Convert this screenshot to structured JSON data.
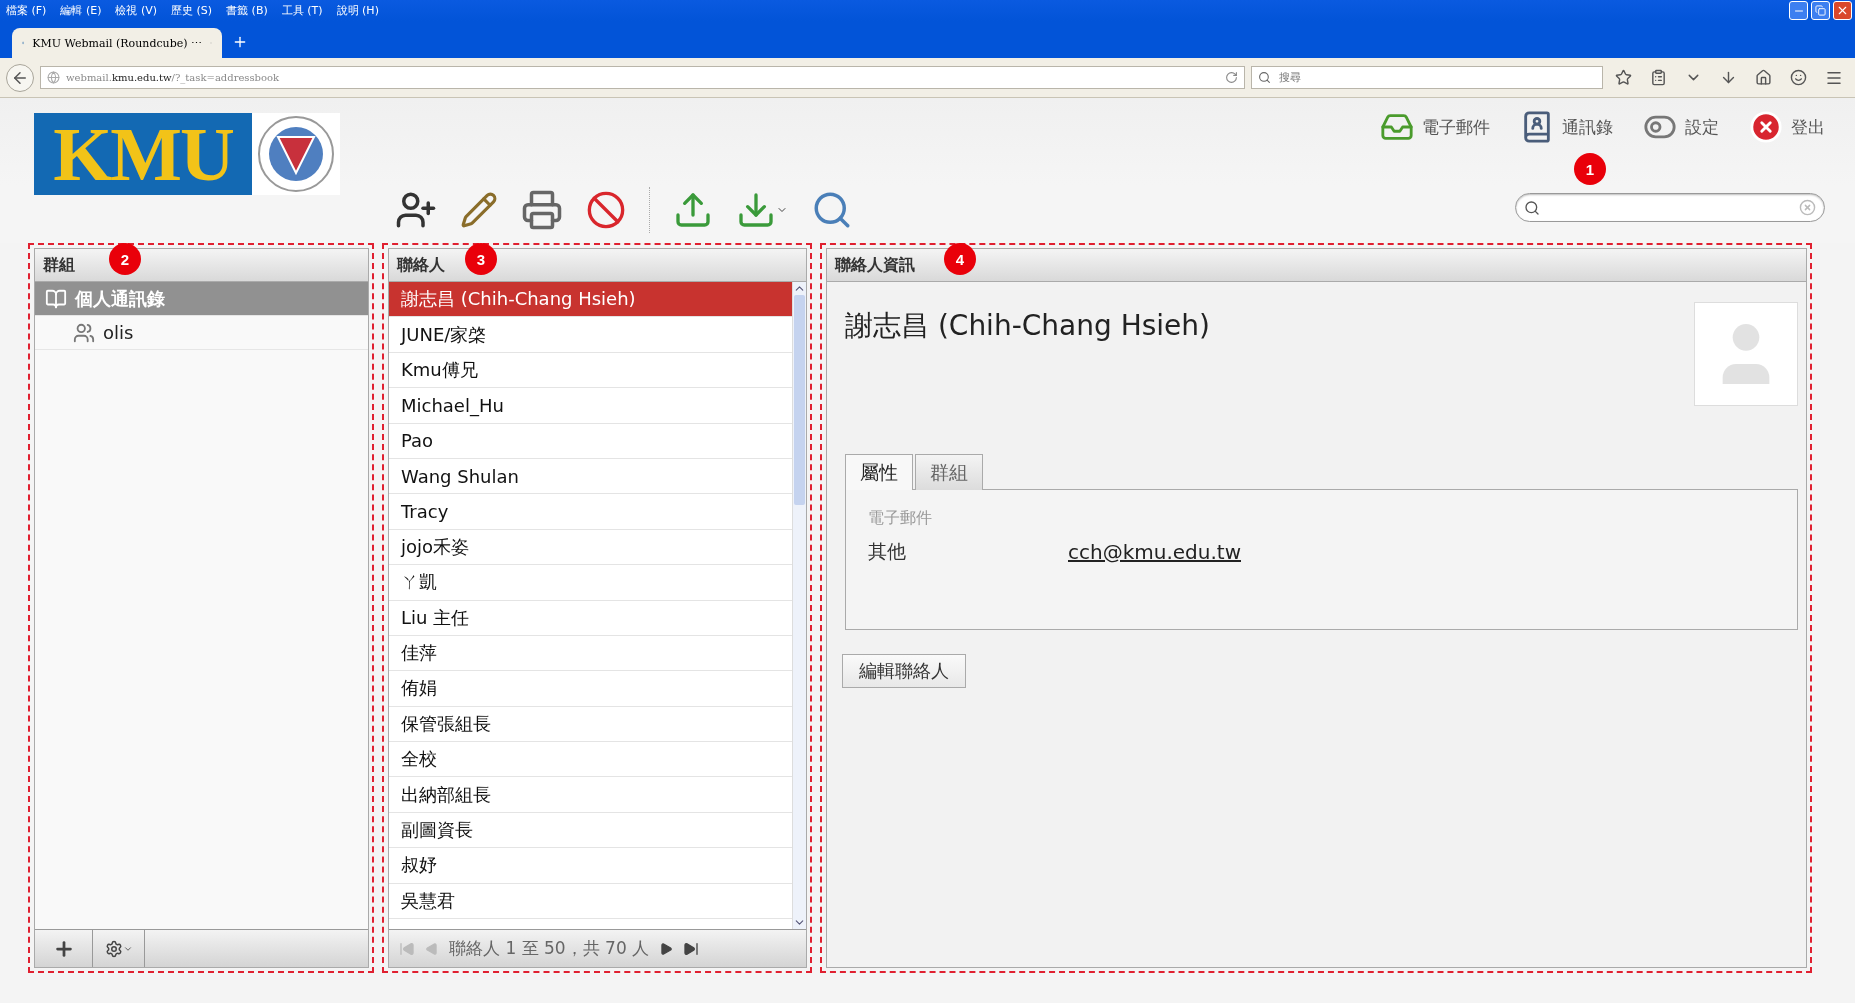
{
  "browser": {
    "menu": [
      "檔案 (F)",
      "編輯 (E)",
      "檢視 (V)",
      "歷史 (S)",
      "書籤 (B)",
      "工具 (T)",
      "說明 (H)"
    ],
    "tab": {
      "title": "KMU Webmail (Roundcube) ⋯"
    },
    "url": {
      "host": "webmail.",
      "domain": "kmu.edu.tw",
      "path": "/?_task=addressbook"
    },
    "search": {
      "placeholder": "搜尋"
    }
  },
  "app": {
    "logo_text": "KMU",
    "nav": [
      {
        "kind": "mail",
        "label": "電子郵件"
      },
      {
        "kind": "addressbook",
        "label": "通訊錄"
      },
      {
        "kind": "settings",
        "label": "設定"
      },
      {
        "kind": "logout",
        "label": "登出"
      }
    ],
    "nav_callout": "1",
    "groups": {
      "title": "群組",
      "callout": "2",
      "items": [
        {
          "label": "個人通訊錄",
          "selected": true,
          "children": [
            {
              "label": "olis",
              "selected": false
            }
          ]
        }
      ]
    },
    "contacts": {
      "title": "聯絡人",
      "callout": "3",
      "rows": [
        {
          "name": "謝志昌 (Chih-Chang Hsieh)",
          "selected": true
        },
        {
          "name": "JUNE/家棨",
          "selected": false
        },
        {
          "name": "Kmu傅兄",
          "selected": false
        },
        {
          "name": "Michael_Hu",
          "selected": false
        },
        {
          "name": "Pao",
          "selected": false
        },
        {
          "name": "Wang Shulan",
          "selected": false
        },
        {
          "name": "Tracy",
          "selected": false
        },
        {
          "name": "jojo禾姿",
          "selected": false
        },
        {
          "name": "ㄚ凱",
          "selected": false
        },
        {
          "name": "Liu 主任",
          "selected": false
        },
        {
          "name": "佳萍",
          "selected": false
        },
        {
          "name": "侑娟",
          "selected": false
        },
        {
          "name": "保管張組長",
          "selected": false
        },
        {
          "name": "全校",
          "selected": false
        },
        {
          "name": "出納部組長",
          "selected": false
        },
        {
          "name": "副圖資長",
          "selected": false
        },
        {
          "name": "叔妤",
          "selected": false
        },
        {
          "name": "吳慧君",
          "selected": false
        }
      ],
      "pager": "聯絡人 1 至 50，共 70 人"
    },
    "detail": {
      "title": "聯絡人資訊",
      "callout": "4",
      "name": "謝志昌 (Chih-Chang Hsieh)",
      "tabs": [
        {
          "label": "屬性",
          "selected": true
        },
        {
          "label": "群組",
          "selected": false
        }
      ],
      "section": "電子郵件",
      "fields": [
        {
          "label": "其他",
          "value": "cch@kmu.edu.tw"
        }
      ],
      "edit_button": "編輯聯絡人"
    }
  }
}
